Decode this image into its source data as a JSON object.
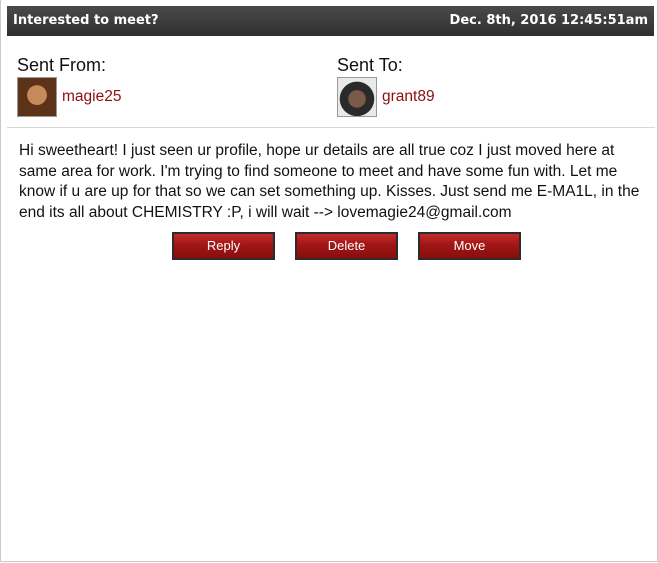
{
  "header": {
    "subject": "Interested to meet?",
    "date": "Dec. 8th, 2016 12:45:51am"
  },
  "sender": {
    "heading": "Sent From:",
    "username": "magie25"
  },
  "recipient": {
    "heading": "Sent To:",
    "username": "grant89"
  },
  "message": {
    "body": "Hi sweetheart! I just seen ur profile, hope ur details are all true coz I just moved here at same area for work. I'm trying to find someone to meet and have some fun with. Let me know if u are up for that so we can set something up. Kisses. Just send me E-MA1L, in the end its all about CHEMISTRY :P, i will wait --> lovemagie24@gmail.com"
  },
  "actions": {
    "reply": "Reply",
    "delete": "Delete",
    "move": "Move"
  },
  "colors": {
    "titlebar": "#3a3a3a",
    "username": "#8b1010",
    "button": "#a01616"
  }
}
